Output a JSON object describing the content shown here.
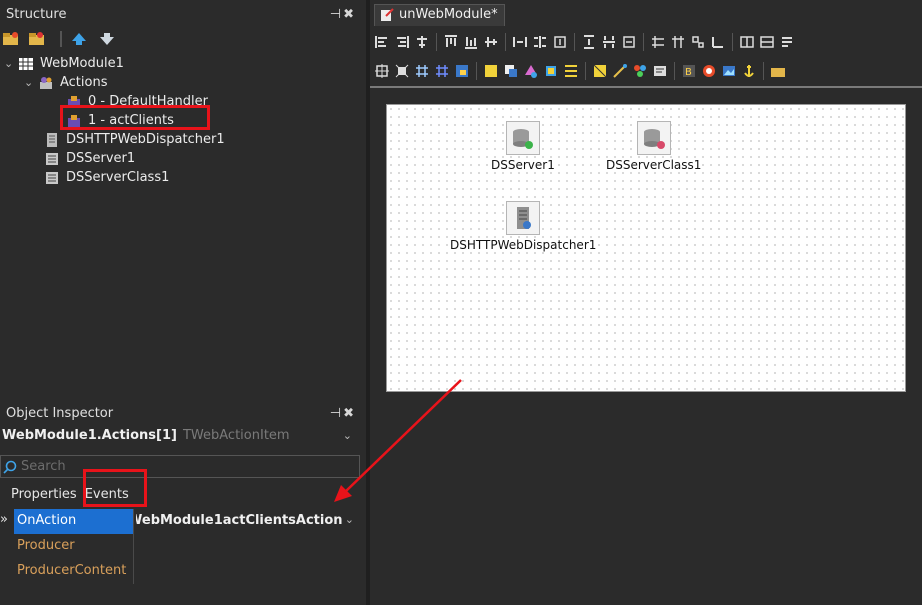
{
  "structure_pane": {
    "title": "Structure",
    "tree": [
      {
        "label": "WebModule1",
        "icon": "webmodule-grid-icon",
        "level": 0
      },
      {
        "label": "Actions",
        "icon": "actions-icon",
        "level": 1
      },
      {
        "label": "0 - DefaultHandler",
        "icon": "action-item-icon",
        "level": 2
      },
      {
        "label": "1 - actClients",
        "icon": "action-item-icon",
        "level": 2,
        "highlighted": true
      },
      {
        "label": "DSHTTPWebDispatcher1",
        "icon": "dispatcher-icon",
        "level": 1
      },
      {
        "label": "DSServer1",
        "icon": "dsserver-icon",
        "level": 1
      },
      {
        "label": "DSServerClass1",
        "icon": "dsserverclass-icon",
        "level": 1
      }
    ]
  },
  "object_inspector": {
    "title": "Object Inspector",
    "object_name": "WebModule1.Actions[1]",
    "object_type": "TWebActionItem",
    "search_placeholder": "Search",
    "tabs": [
      "Properties",
      "Events"
    ],
    "active_tab": "Events",
    "rows": [
      {
        "name": "OnAction",
        "value": "WebModule1actClientsAction",
        "selected": true
      },
      {
        "name": "Producer",
        "value": ""
      },
      {
        "name": "ProducerContent",
        "value": ""
      }
    ]
  },
  "designer": {
    "tab_label": "unWebModule*",
    "components": [
      {
        "label": "DSServer1",
        "icon": "dsserver-icon"
      },
      {
        "label": "DSServerClass1",
        "icon": "dsserverclass-icon"
      },
      {
        "label": "DSHTTPWebDispatcher1",
        "icon": "dispatcher-icon"
      }
    ]
  },
  "colors": {
    "highlight_box": "#e8131a",
    "selected_row": "#1c6fd1",
    "property_name": "#d9a05b"
  }
}
